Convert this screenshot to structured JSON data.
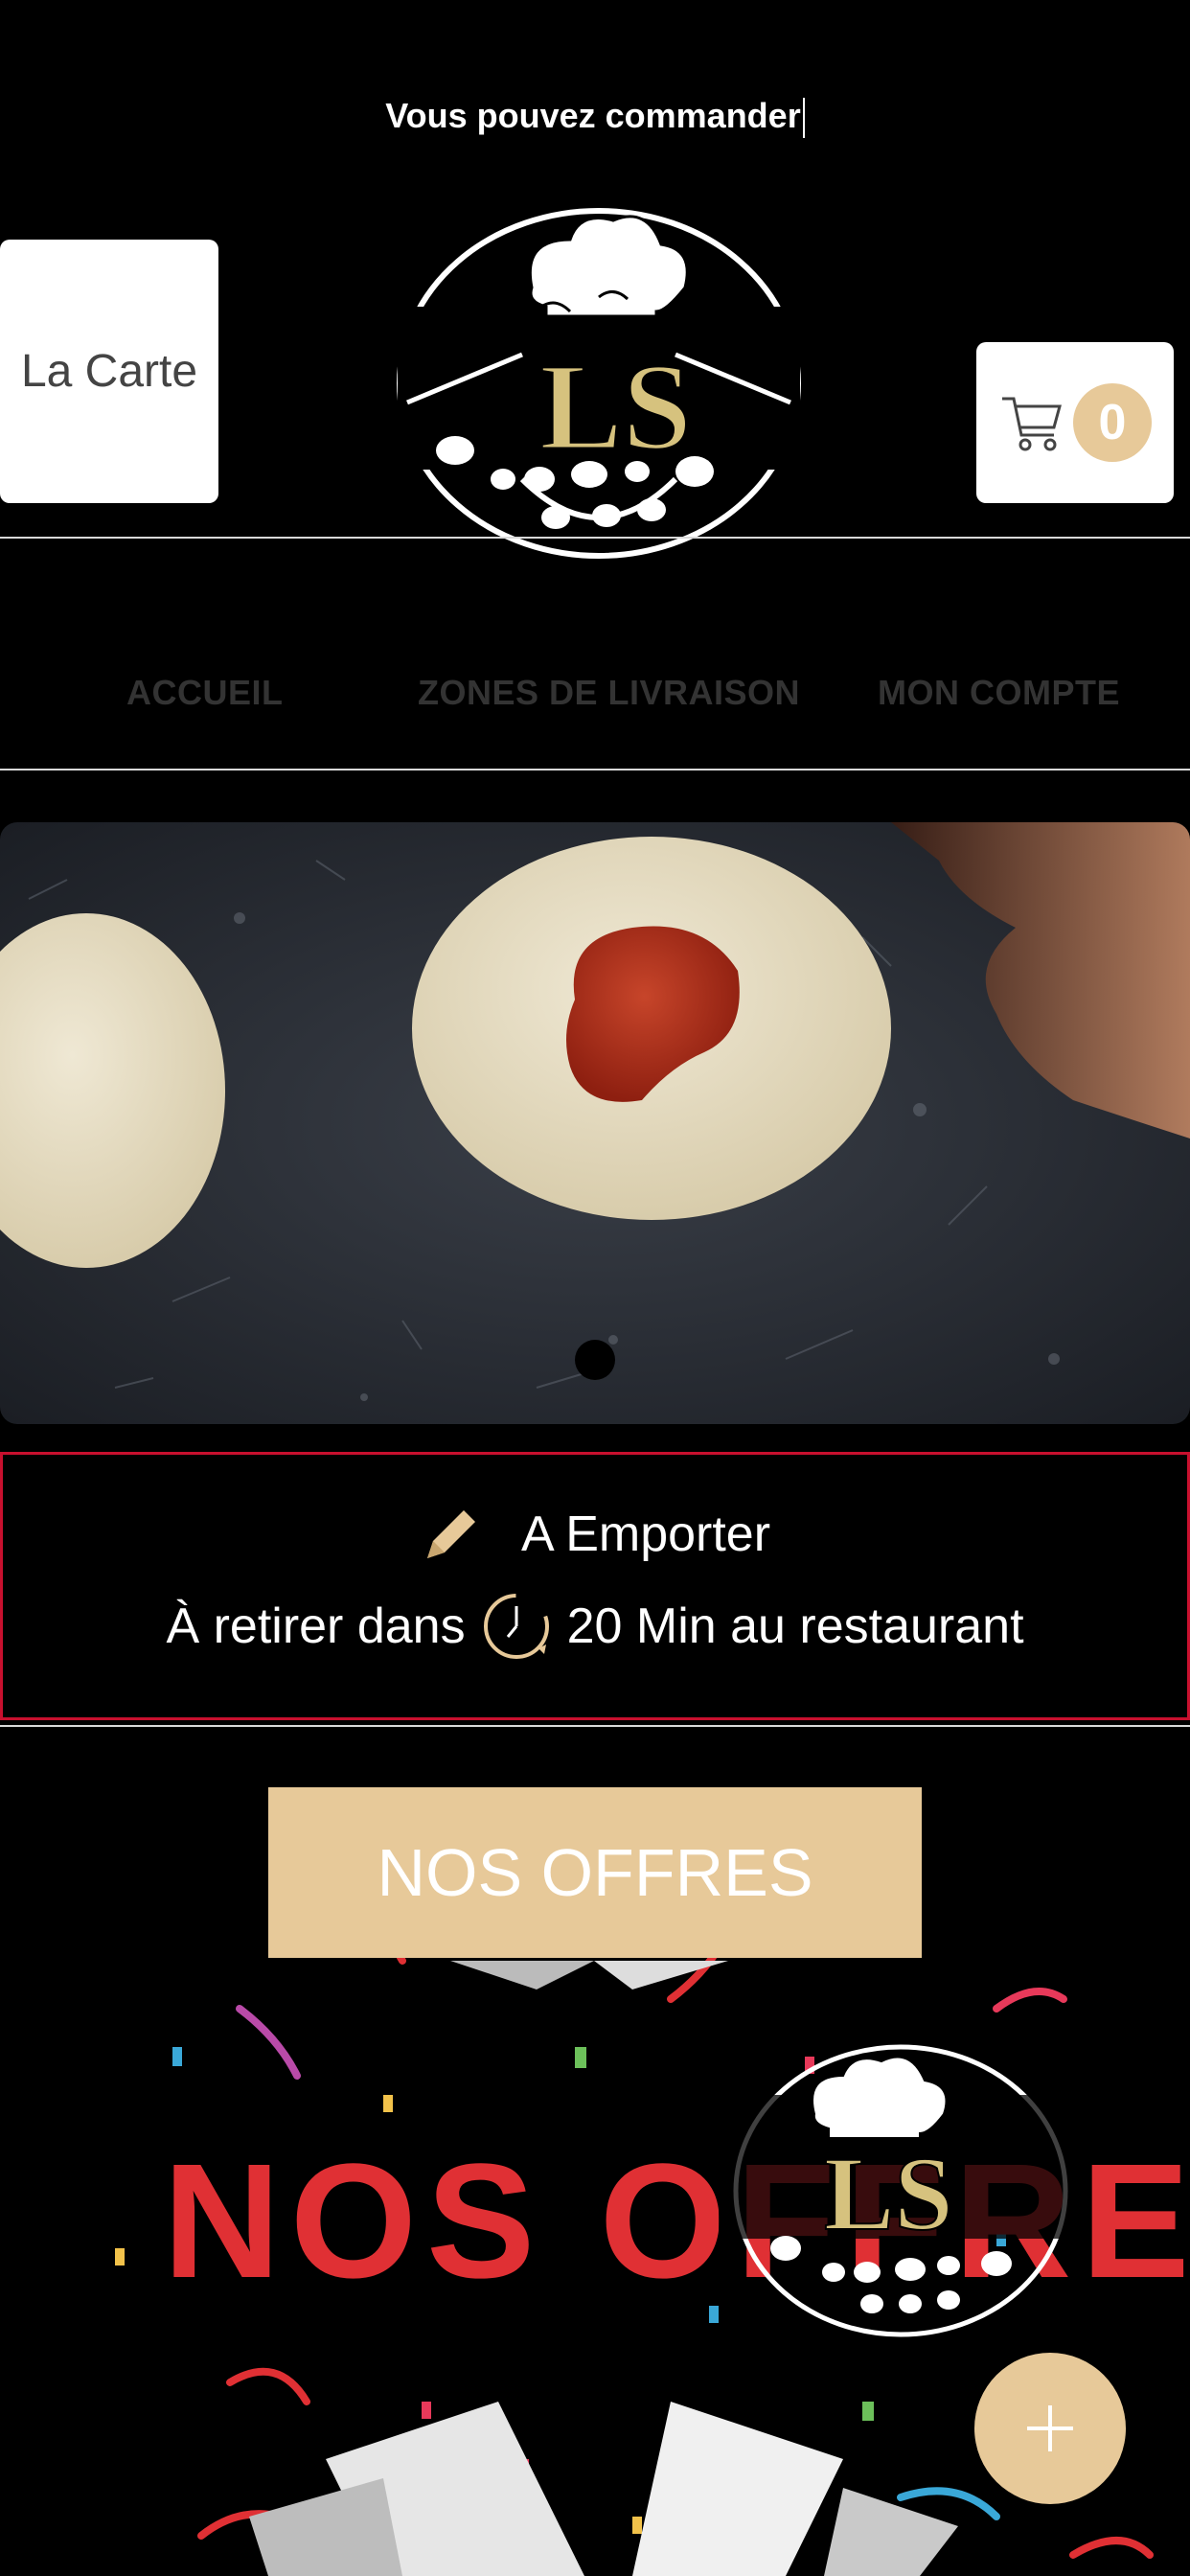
{
  "status": {
    "text": "Vous pouvez commander"
  },
  "header": {
    "menu_button_label": "La Carte",
    "cart_count": "0",
    "logo_letters": "LS"
  },
  "nav": {
    "items": [
      {
        "label": "ACCUEIL"
      },
      {
        "label": "ZONES DE LIVRAISON"
      },
      {
        "label": "MON COMPTE"
      }
    ]
  },
  "pickup": {
    "mode": "A Emporter",
    "prefix": "À retirer dans",
    "time": "20 Min au restaurant"
  },
  "offers": {
    "button_label": "NOS OFFRES",
    "banner_text": "NOS OFFRES"
  },
  "colors": {
    "accent": "#e7c999",
    "border_red": "#c8102e",
    "background": "#000000"
  }
}
